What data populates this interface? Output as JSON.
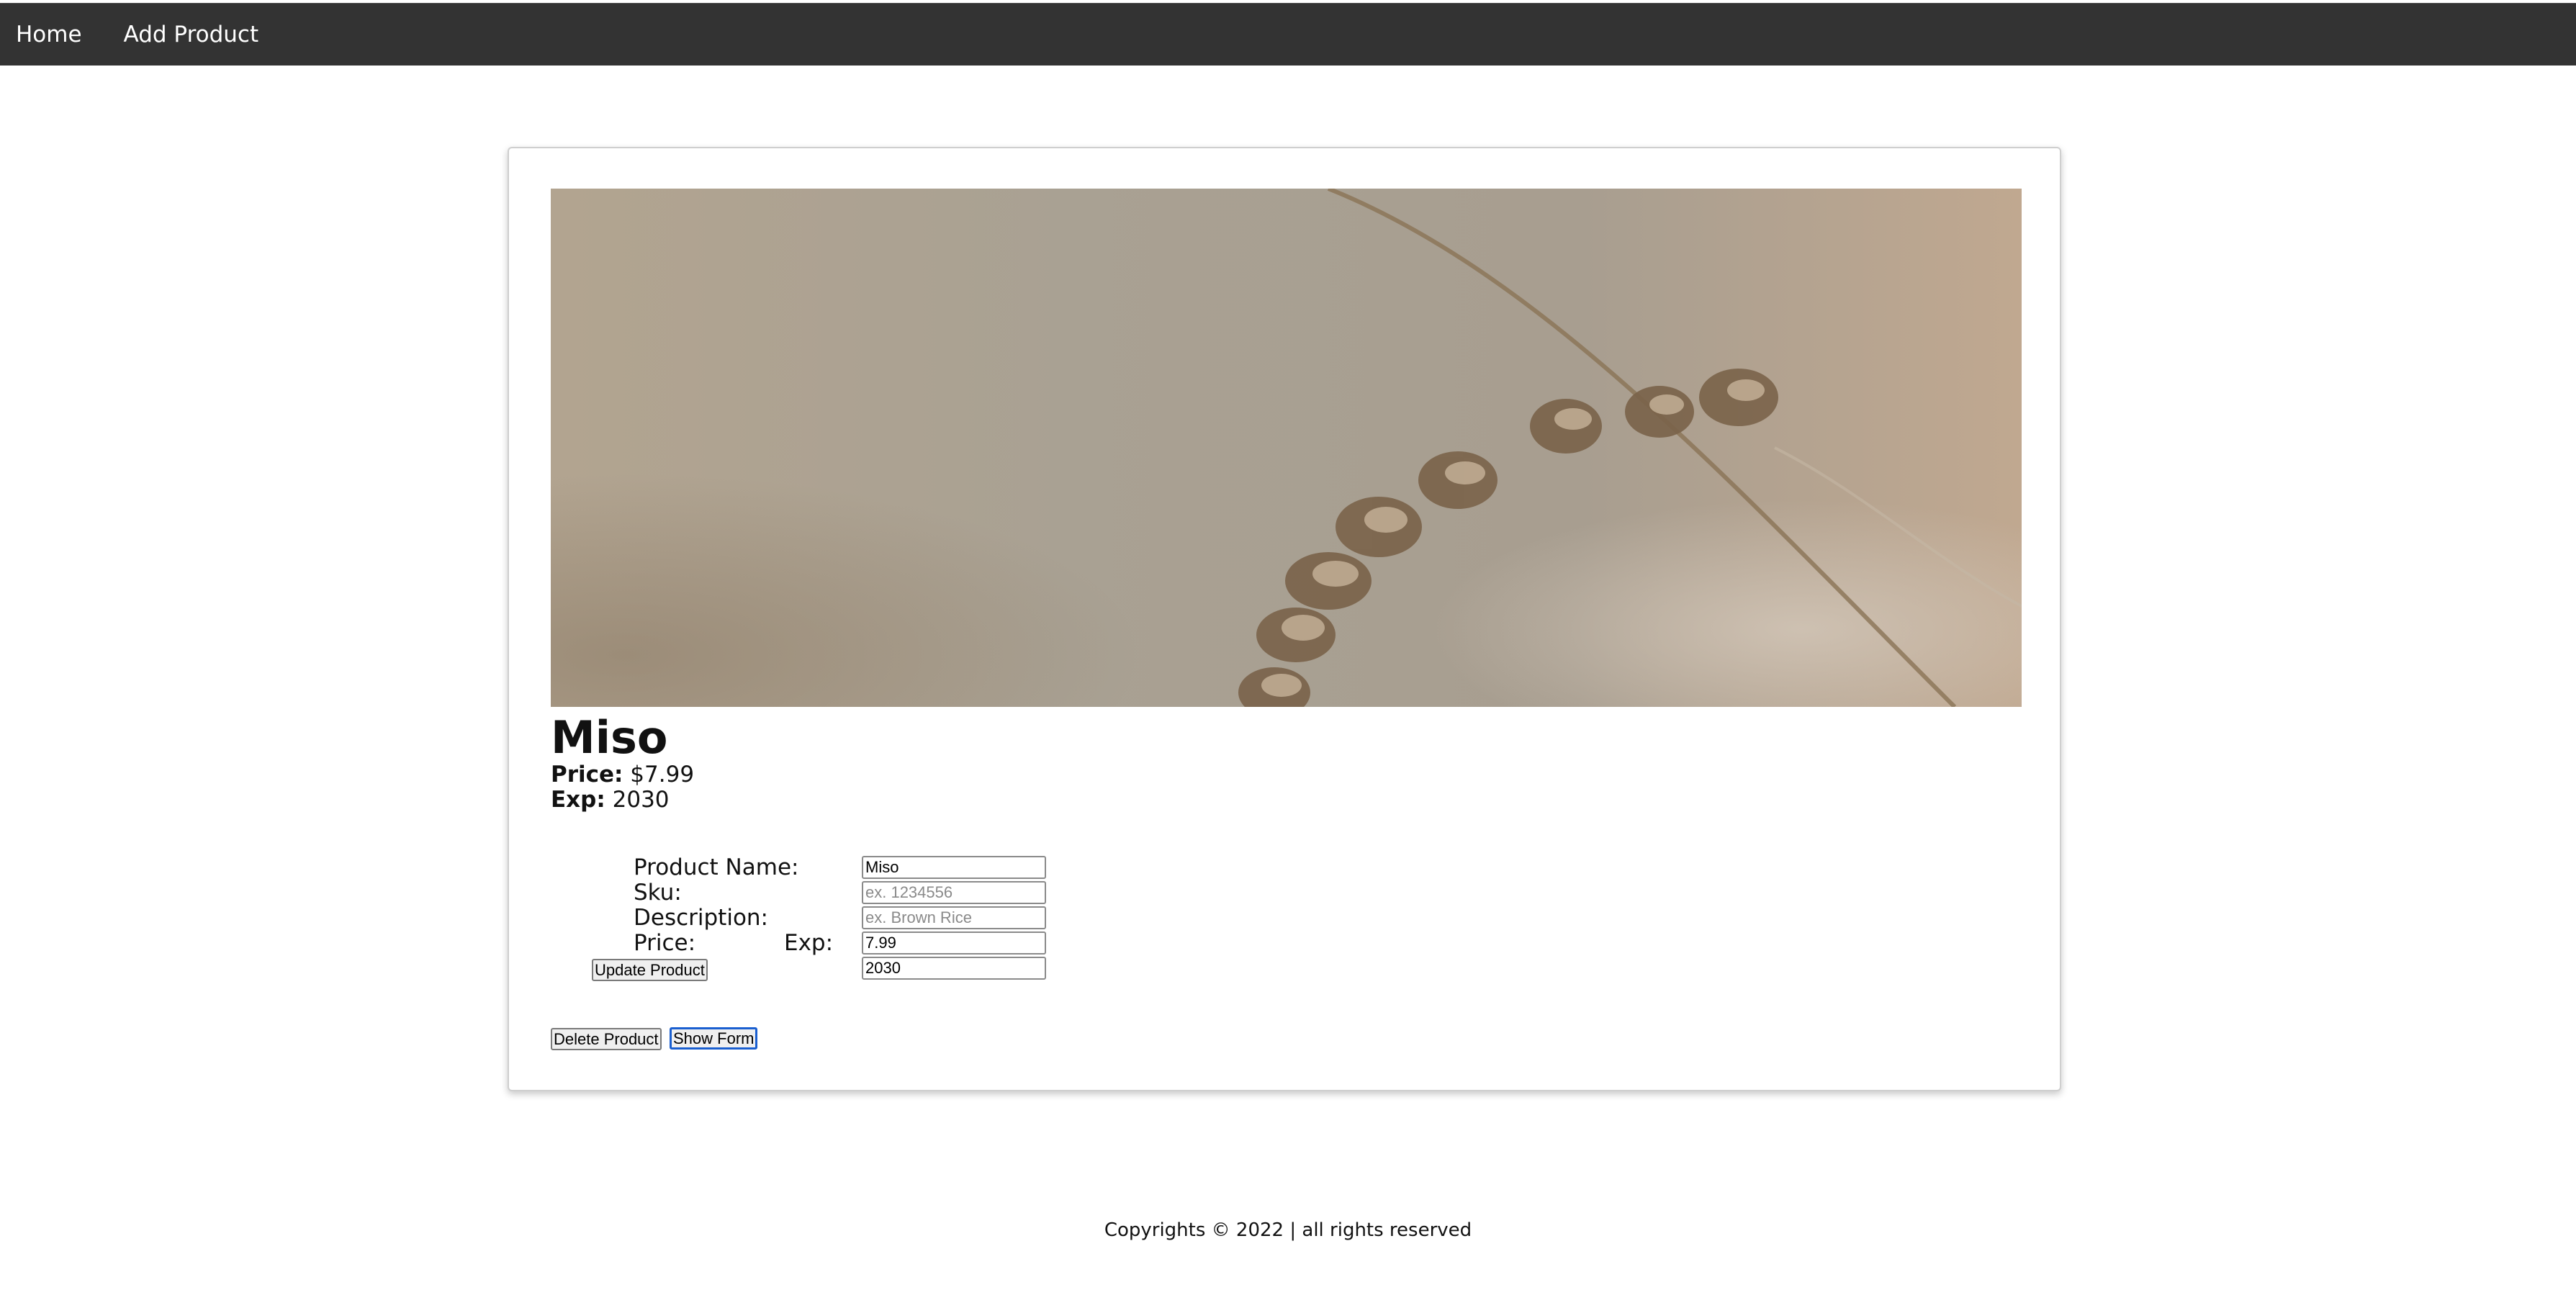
{
  "nav": {
    "home_label": "Home",
    "add_product_label": "Add Product"
  },
  "product": {
    "name": "Miso",
    "price_label": "Price:",
    "price_value": "$7.99",
    "exp_label": "Exp:",
    "exp_value": "2030"
  },
  "form": {
    "product_name_label": "Product Name:",
    "sku_label": "Sku:",
    "description_label": "Description:",
    "price_label": "Price:",
    "exp_label": "Exp:",
    "product_name_value": "Miso",
    "sku_value": "",
    "sku_placeholder": "ex. 1234556",
    "description_value": "",
    "description_placeholder": "ex. Brown Rice",
    "price_value": "7.99",
    "exp_value": "2030",
    "update_button": "Update Product"
  },
  "actions": {
    "delete_button": "Delete Product",
    "show_form_button": "Show Form"
  },
  "footer": {
    "text": "Copyrights © 2022 | all rights reserved"
  },
  "colors": {
    "navbar_bg": "#333333",
    "focus_ring": "#1a5fd0"
  }
}
